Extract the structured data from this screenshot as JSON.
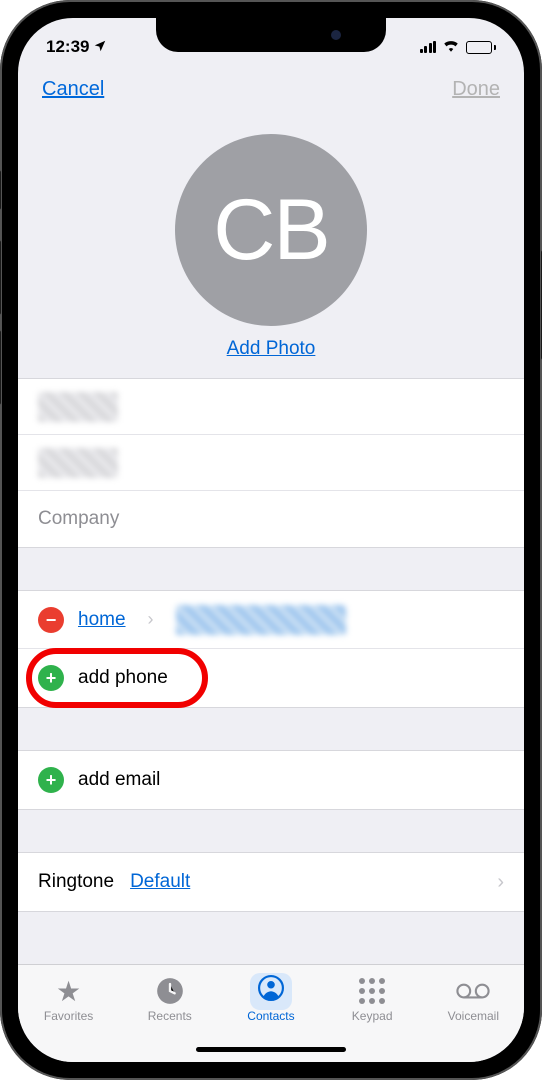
{
  "status": {
    "time": "12:39"
  },
  "nav": {
    "cancel": "Cancel",
    "done": "Done"
  },
  "avatar": {
    "initials": "CB",
    "addPhoto": "Add Photo"
  },
  "fields": {
    "company": "Company"
  },
  "phone": {
    "homeLabel": "home",
    "addPhone": "add phone"
  },
  "email": {
    "addEmail": "add email"
  },
  "ringtone": {
    "label": "Ringtone",
    "value": "Default"
  },
  "tabs": {
    "favorites": "Favorites",
    "recents": "Recents",
    "contacts": "Contacts",
    "keypad": "Keypad",
    "voicemail": "Voicemail"
  }
}
